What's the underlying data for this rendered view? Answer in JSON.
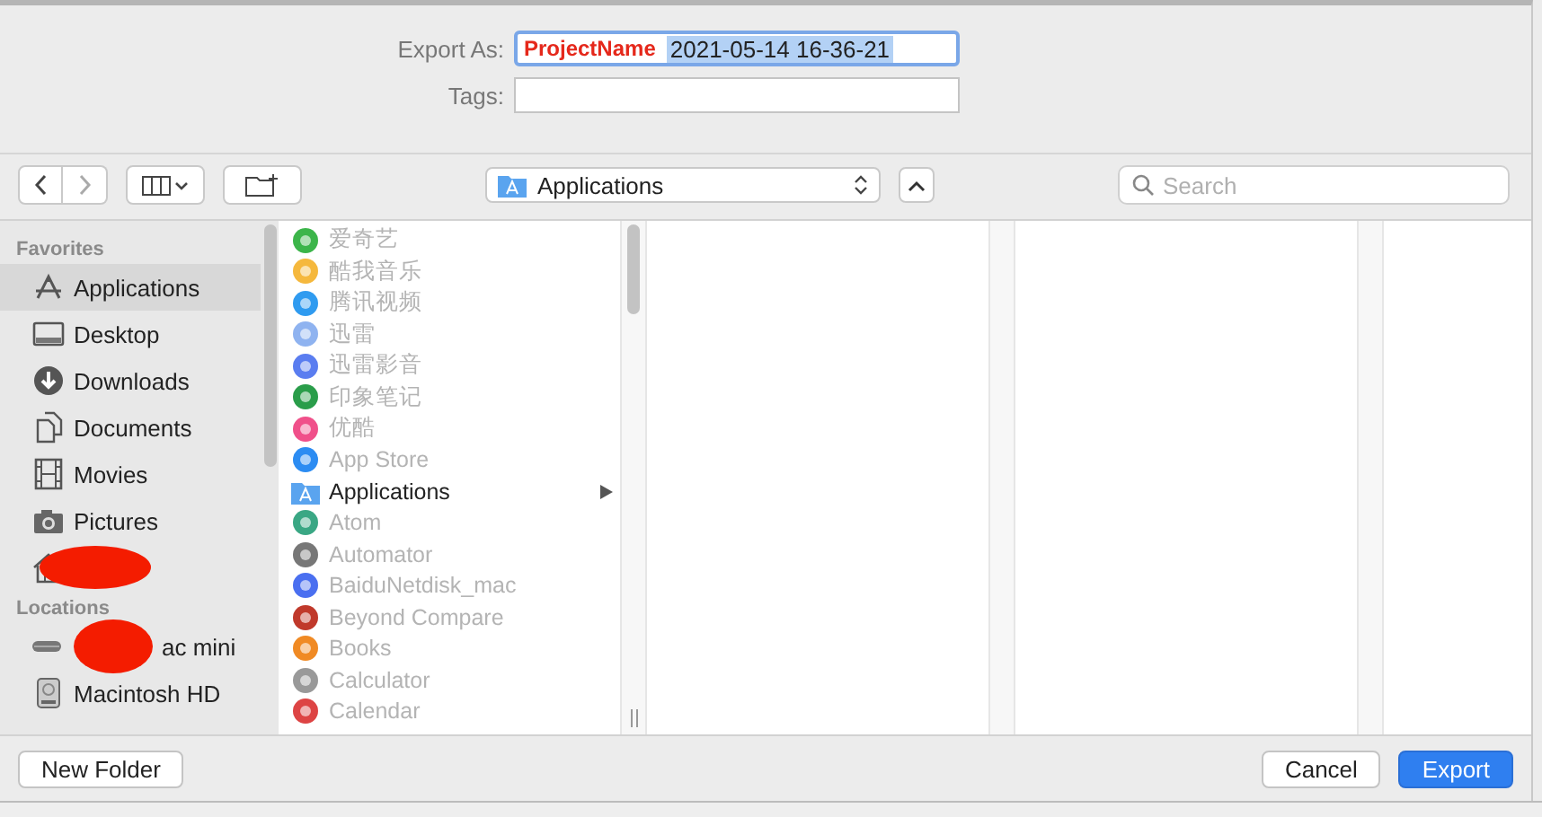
{
  "export_form": {
    "export_as_label": "Export As:",
    "export_as": {
      "annotation": "ProjectName",
      "value": "2021-05-14 16-36-21",
      "selected": true
    },
    "tags_label": "Tags:"
  },
  "toolbar": {
    "location": "Applications",
    "search": {
      "placeholder": "Search"
    }
  },
  "sidebar": {
    "sections": [
      {
        "title": "Favorites",
        "items": [
          {
            "kind": "applications",
            "label": "Applications",
            "selected": true
          },
          {
            "kind": "desktop",
            "label": "Desktop",
            "selected": false
          },
          {
            "kind": "downloads",
            "label": "Downloads",
            "selected": false
          },
          {
            "kind": "documents",
            "label": "Documents",
            "selected": false
          },
          {
            "kind": "movies",
            "label": "Movies",
            "selected": false
          },
          {
            "kind": "pictures",
            "label": "Pictures",
            "selected": false
          },
          {
            "kind": "home",
            "redacted": true,
            "selected": false
          }
        ]
      },
      {
        "title": "Locations",
        "items": [
          {
            "kind": "computer",
            "label": "ac mini",
            "redacted": true,
            "selected": false
          },
          {
            "kind": "disk",
            "label": "Macintosh HD",
            "selected": false
          }
        ]
      }
    ]
  },
  "browser": {
    "items": [
      {
        "kind": "app",
        "label": "爱奇艺",
        "disabled": true
      },
      {
        "kind": "app",
        "label": "酷我音乐",
        "disabled": true
      },
      {
        "kind": "app",
        "label": "腾讯视频",
        "disabled": true
      },
      {
        "kind": "app",
        "label": "迅雷",
        "disabled": true
      },
      {
        "kind": "app",
        "label": "迅雷影音",
        "disabled": true
      },
      {
        "kind": "app",
        "label": "印象笔记",
        "disabled": true
      },
      {
        "kind": "app",
        "label": "优酷",
        "disabled": true
      },
      {
        "kind": "app",
        "label": "App Store",
        "disabled": true
      },
      {
        "kind": "folder",
        "label": "Applications",
        "disabled": false
      },
      {
        "kind": "app",
        "label": "Atom",
        "disabled": true
      },
      {
        "kind": "app",
        "label": "Automator",
        "disabled": true
      },
      {
        "kind": "app",
        "label": "BaiduNetdisk_mac",
        "disabled": true
      },
      {
        "kind": "app",
        "label": "Beyond Compare",
        "disabled": true
      },
      {
        "kind": "app",
        "label": "Books",
        "disabled": true
      },
      {
        "kind": "app",
        "label": "Calculator",
        "disabled": true
      },
      {
        "kind": "app",
        "label": "Calendar",
        "disabled": true
      }
    ]
  },
  "buttons": [
    {
      "kind": "plain",
      "label": "New Folder"
    },
    {
      "kind": "plain",
      "label": "Cancel"
    },
    {
      "kind": "default",
      "label": "Export"
    }
  ]
}
